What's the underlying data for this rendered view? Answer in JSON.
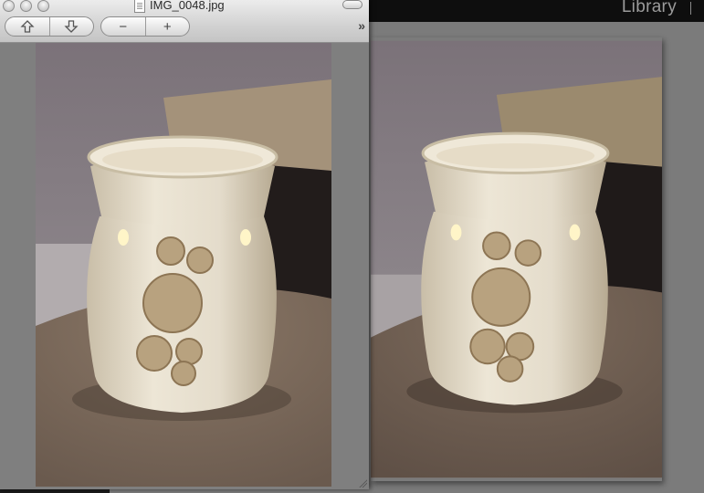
{
  "lightroom": {
    "module_label": "Library"
  },
  "preview_window": {
    "title": "IMG_0048.jpg",
    "toolbar": {
      "nav_icons": [
        "arrow-up-icon",
        "arrow-down-icon"
      ],
      "zoom_icons": [
        "zoom-out-icon",
        "zoom-in-icon"
      ],
      "zoom_out_label": "−",
      "zoom_in_label": "+",
      "overflow_label": "»"
    }
  },
  "colors": {
    "background_gray": "#7c7c7c",
    "lightroom_bar": "#0e0e0e",
    "warmer_cream": "#e8e0cf",
    "granite": "#8a7766"
  }
}
